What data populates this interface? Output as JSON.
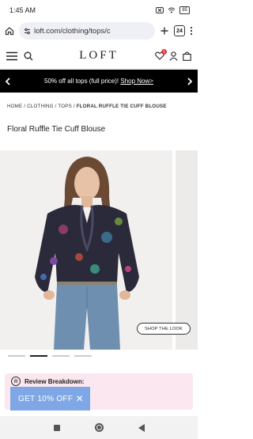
{
  "status_bar": {
    "time": "1:45 AM",
    "battery": "85"
  },
  "browser": {
    "url": "loft.com/clothing/tops/c",
    "tab_count": "24"
  },
  "site": {
    "logo": "LOFT",
    "wishlist_count": "1"
  },
  "promo": {
    "text": "50% off all tops (full price)!",
    "link": "Shop Now>"
  },
  "breadcrumb": {
    "items": [
      "HOME",
      "CLOTHING",
      "TOPS"
    ],
    "current": "FLORAL RUFFLE TIE CUFF BLOUSE",
    "sep": "/"
  },
  "product": {
    "title": "Floral Ruffle Tie Cuff Blouse",
    "shop_the_look": "SHOP THE LOOK"
  },
  "review": {
    "label": "Review Breakdown:"
  },
  "offer": {
    "label": "GET 10% OFF",
    "close": "✕"
  },
  "colors": {
    "promo_bg": "#000000",
    "review_bg": "#fbe7ef",
    "offer_bg": "#7fa7e5"
  }
}
